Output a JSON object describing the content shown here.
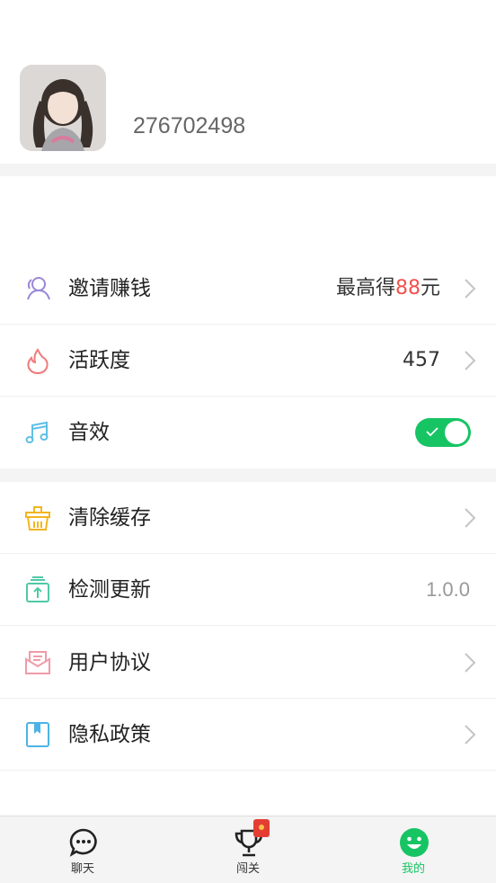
{
  "profile": {
    "user_id": "276702498"
  },
  "menu_group_1": [
    {
      "key": "invite",
      "icon": "invite-user-icon",
      "label": "邀请赚钱",
      "value_prefix": "最高得",
      "value_highlight": "88",
      "value_suffix": "元",
      "accent": "#9a88d6"
    },
    {
      "key": "activity",
      "icon": "flame-icon",
      "label": "活跃度",
      "value": "457",
      "accent": "#f07c7c"
    },
    {
      "key": "sound",
      "icon": "music-note-icon",
      "label": "音效",
      "toggle_on": true,
      "accent": "#5ec0e6"
    }
  ],
  "menu_group_2": [
    {
      "key": "clear_cache",
      "icon": "trash-basket-icon",
      "label": "清除缓存",
      "accent": "#f2b51f"
    },
    {
      "key": "check_update",
      "icon": "update-box-icon",
      "label": "检测更新",
      "value": "1.0.0",
      "accent": "#4fc9a6"
    },
    {
      "key": "user_agreement",
      "icon": "envelope-icon",
      "label": "用户协议",
      "accent": "#f29aa8"
    },
    {
      "key": "privacy_policy",
      "icon": "bookmark-book-icon",
      "label": "隐私政策",
      "accent": "#4db3e6"
    }
  ],
  "tabbar": {
    "tabs": [
      {
        "label": "聊天",
        "icon": "chat-bubble-icon",
        "active": false
      },
      {
        "label": "闯关",
        "icon": "trophy-icon",
        "active": false,
        "badge": "red-envelope-badge"
      },
      {
        "label": "我的",
        "icon": "smiley-face-icon",
        "active": true
      }
    ]
  },
  "colors": {
    "primary_green": "#17c464",
    "highlight_red": "#f0524e",
    "section_gap": "#f4f4f4"
  }
}
